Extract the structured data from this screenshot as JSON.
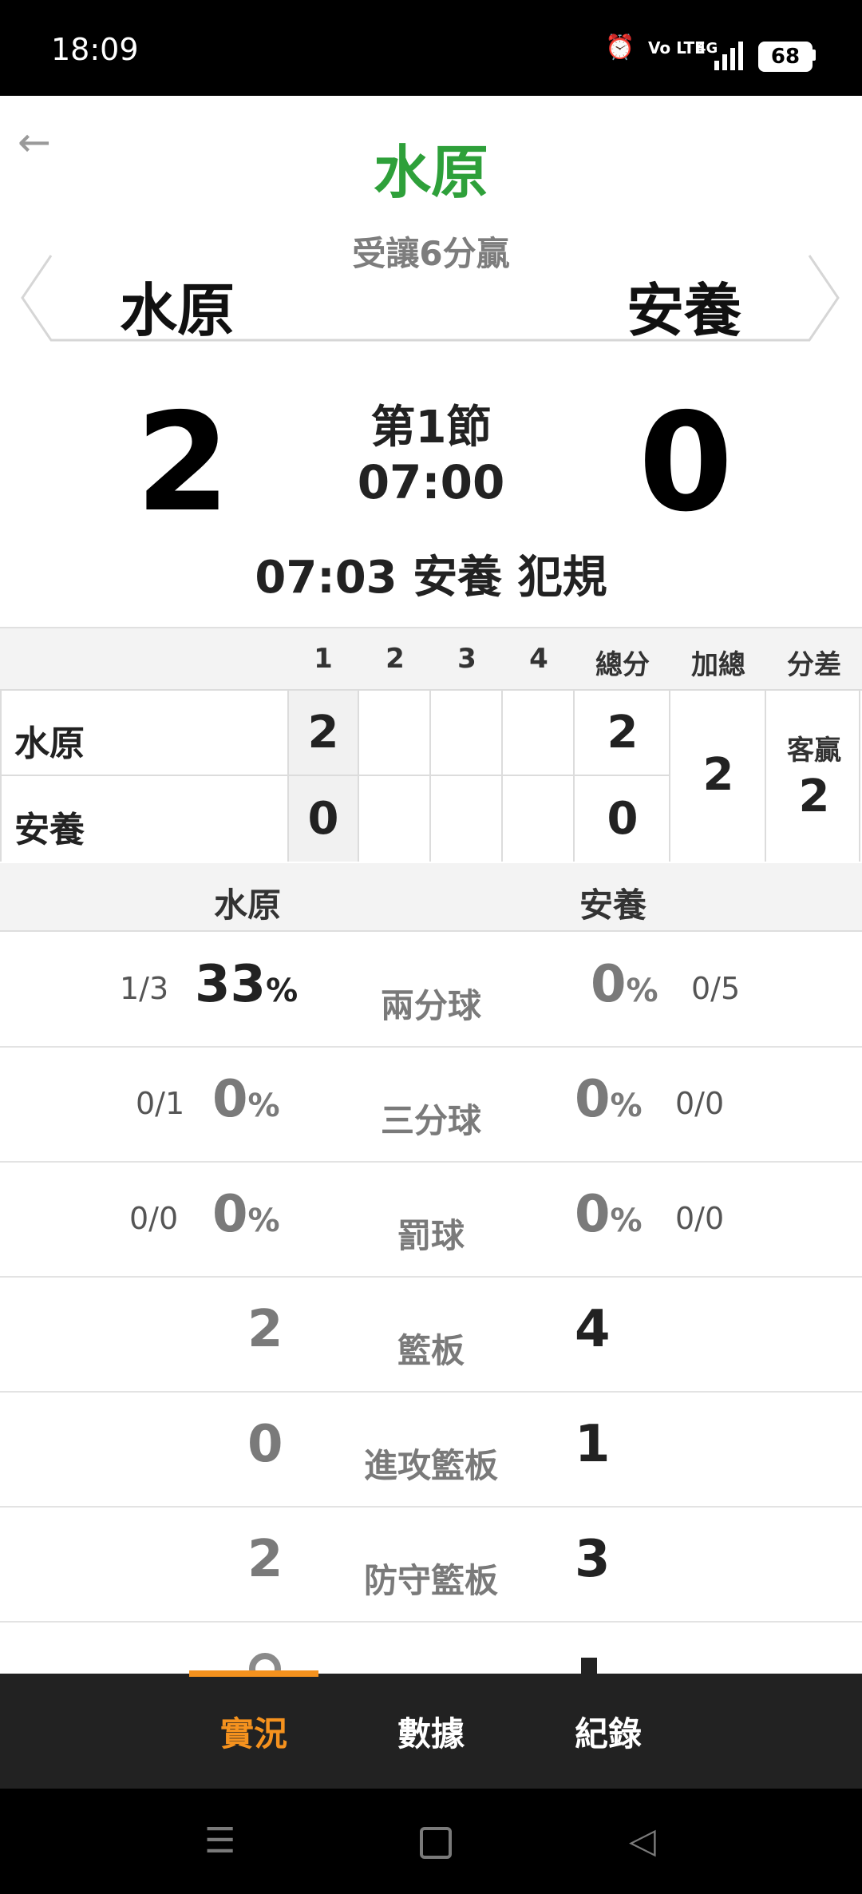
{
  "status_bar": {
    "time": "18:09",
    "volte": "Vo LTE",
    "network": "4G",
    "battery": "68"
  },
  "header": {
    "pick_team": "水原",
    "pick_note": "受讓6分贏",
    "home_team": "水原",
    "away_team": "安養"
  },
  "score": {
    "home": "2",
    "away": "0",
    "period": "第1節",
    "clock": "07:00",
    "last_play": "07:03 安養  犯規"
  },
  "quarter_table": {
    "headers": [
      "1",
      "2",
      "3",
      "4",
      "總分",
      "加總",
      "分差"
    ],
    "rows": [
      {
        "team": "水原",
        "q": [
          "2",
          "",
          "",
          ""
        ],
        "total": "2"
      },
      {
        "team": "安養",
        "q": [
          "0",
          "",
          "",
          ""
        ],
        "total": "0"
      }
    ],
    "sum_total": "2",
    "diff_label": "客贏",
    "diff_value": "2"
  },
  "stats": {
    "home_team": "水原",
    "away_team": "安養",
    "rows": [
      {
        "label": "兩分球",
        "home_ratio": "1/3",
        "home_pct": "33",
        "away_pct": "0",
        "away_ratio": "0/5"
      },
      {
        "label": "三分球",
        "home_ratio": "0/1",
        "home_pct": "0",
        "away_pct": "0",
        "away_ratio": "0/0"
      },
      {
        "label": "罰球",
        "home_ratio": "0/0",
        "home_pct": "0",
        "away_pct": "0",
        "away_ratio": "0/0"
      },
      {
        "label": "籃板",
        "home": "2",
        "away": "4"
      },
      {
        "label": "進攻籃板",
        "home": "0",
        "away": "1"
      },
      {
        "label": "防守籃板",
        "home": "2",
        "away": "3"
      }
    ],
    "pct_sign": "%"
  },
  "tabs": [
    "實況",
    "數據",
    "紀錄"
  ],
  "colors": {
    "accent": "#f5921e",
    "pick_green": "#2ea03a",
    "tabbar": "#222222"
  }
}
